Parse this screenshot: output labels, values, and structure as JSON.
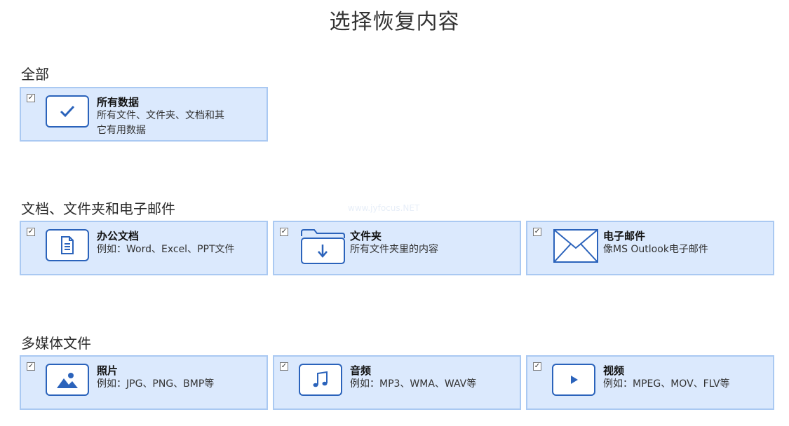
{
  "page_title": "选择恢复内容",
  "watermark": "www.jyfocus.NET",
  "sections": [
    {
      "heading": "全部",
      "cards": [
        {
          "title": "所有数据",
          "desc": "所有文件、文件夹、文档和其\n它有用数据",
          "icon": "checkmark-icon",
          "checked": true
        }
      ]
    },
    {
      "heading": "文档、文件夹和电子邮件",
      "cards": [
        {
          "title": "办公文档",
          "desc": "例如：Word、Excel、PPT文件",
          "icon": "document-icon",
          "checked": true
        },
        {
          "title": "文件夹",
          "desc": "所有文件夹里的内容",
          "icon": "folder-icon",
          "checked": true
        },
        {
          "title": "电子邮件",
          "desc": "像MS Outlook电子邮件",
          "icon": "envelope-icon",
          "checked": true
        }
      ]
    },
    {
      "heading": "多媒体文件",
      "cards": [
        {
          "title": "照片",
          "desc": "例如：JPG、PNG、BMP等",
          "icon": "photo-icon",
          "checked": true
        },
        {
          "title": "音频",
          "desc": "例如：MP3、WMA、WAV等",
          "icon": "music-note-icon",
          "checked": true
        },
        {
          "title": "视频",
          "desc": "例如：MPEG、MOV、FLV等",
          "icon": "play-icon",
          "checked": true
        }
      ]
    }
  ],
  "colors": {
    "card_bg": "#dbe9fd",
    "card_border": "#aac9f2",
    "icon_blue": "#2b63bb"
  }
}
